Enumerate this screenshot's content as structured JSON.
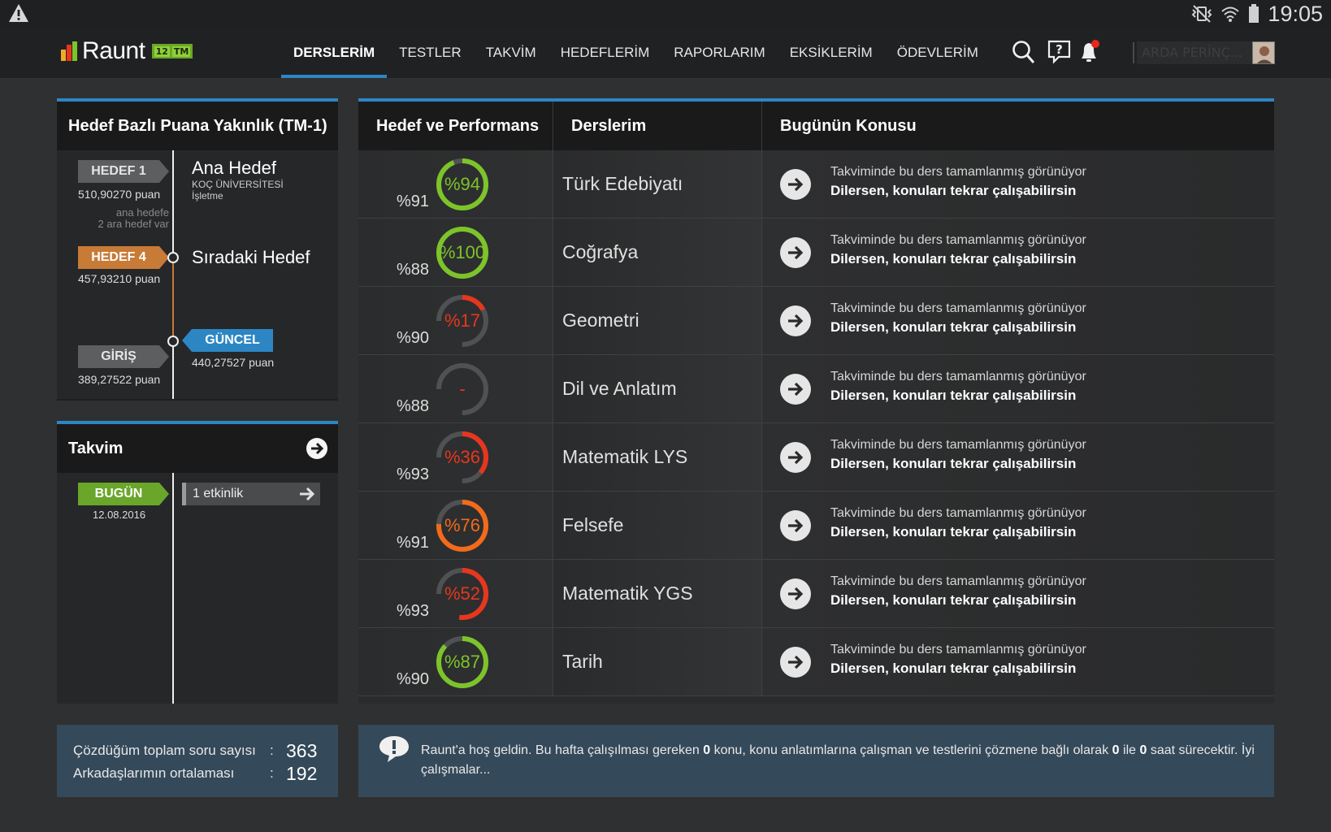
{
  "status_bar": {
    "time": "19:05"
  },
  "header": {
    "logo_text": "Raunt",
    "logo_badge_grade": "12",
    "logo_badge_track": "TM",
    "nav": [
      "DERSLERİM",
      "TESTLER",
      "TAKVİM",
      "HEDEFLERİM",
      "RAPORLARIM",
      "EKSİKLERİM",
      "ÖDEVLERİM"
    ],
    "active_nav": "DERSLERİM",
    "user_name": "ARDA PERİNÇ..."
  },
  "goal_panel": {
    "title": "Hedef Bazlı Puana Yakınlık (TM-1)",
    "main_goal": {
      "tag": "HEDEF 1",
      "points": "510,90270 puan",
      "label": "Ana Hedef",
      "university": "KOÇ ÜNİVERSİTESİ",
      "department": "İşletme"
    },
    "intermediate_note_1": "ana hedefe",
    "intermediate_note_2": "2 ara hedef var",
    "next_goal": {
      "tag": "HEDEF 4",
      "points": "457,93210 puan",
      "label": "Sıradaki Hedef"
    },
    "current": {
      "tag": "GÜNCEL",
      "points": "440,27527 puan"
    },
    "entry": {
      "tag": "GİRİŞ",
      "points": "389,27522 puan"
    }
  },
  "calendar_panel": {
    "title": "Takvim",
    "today_tag": "BUGÜN",
    "today_date": "12.08.2016",
    "event_count": "1",
    "event_label": "etkinlik"
  },
  "lessons_table": {
    "headers": [
      "Hedef ve Performans",
      "Derslerim",
      "Bugünün Konusu"
    ],
    "topic_line1": "Takviminde bu ders tamamlanmış görünüyor",
    "topic_line2": "Dilersen, konuları tekrar çalışabilirsin",
    "rows": [
      {
        "target": "%91",
        "performance": "%94",
        "perf_value": 94,
        "lesson": "Türk Edebiyatı",
        "color": "#7cc42a"
      },
      {
        "target": "%88",
        "performance": "%100",
        "perf_value": 100,
        "lesson": "Coğrafya",
        "color": "#7cc42a"
      },
      {
        "target": "%90",
        "performance": "%17",
        "perf_value": 17,
        "lesson": "Geometri",
        "color": "#e8361e"
      },
      {
        "target": "%88",
        "performance": "-",
        "perf_value": 0,
        "lesson": "Dil ve Anlatım",
        "color": "#e8361e"
      },
      {
        "target": "%93",
        "performance": "%36",
        "perf_value": 36,
        "lesson": "Matematik LYS",
        "color": "#e8361e"
      },
      {
        "target": "%91",
        "performance": "%76",
        "perf_value": 76,
        "lesson": "Felsefe",
        "color": "#f26a1b"
      },
      {
        "target": "%93",
        "performance": "%52",
        "perf_value": 52,
        "lesson": "Matematik YGS",
        "color": "#e8361e"
      },
      {
        "target": "%90",
        "performance": "%87",
        "perf_value": 87,
        "lesson": "Tarih",
        "color": "#7cc42a"
      }
    ]
  },
  "stats": {
    "solved_label": "Çözdüğüm toplam soru sayısı",
    "solved_value": "363",
    "friends_label": "Arkadaşlarımın ortalaması",
    "friends_value": "192",
    "colon": ":"
  },
  "welcome": {
    "part1": "Raunt'a hoş geldin. Bu hafta çalışılması gereken ",
    "topics": "0",
    "part2": " konu, konu anlatımlarına çalışman ve testlerini çözmene bağlı olarak ",
    "hours_min": "0",
    "part3": " ile ",
    "hours_max": "0",
    "part4": " saat sürecektir. İyi çalışmalar..."
  }
}
